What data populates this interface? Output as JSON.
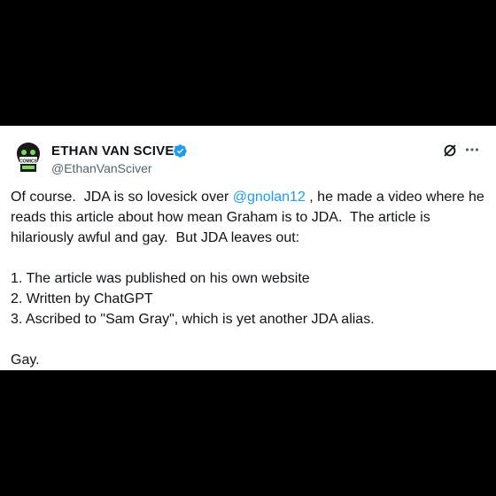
{
  "tweet": {
    "author": {
      "name": "ETHAN VAN SCIVER",
      "handle": "@EthanVanSciver",
      "avatar_text": "COMICS"
    },
    "text": {
      "line1_pre": "Of course.  JDA is so lovesick over ",
      "mention": "@gnolan12",
      "line1_post": " , he made a video where he reads this article about how mean Graham is to JDA.  The article is hilariously awful and gay.  But JDA leaves out:",
      "list": [
        "1. The article was published on his own website",
        "2. Written by ChatGPT",
        "3. Ascribed to \"Sam Gray\", which is yet another JDA alias."
      ],
      "closing": "Gay."
    },
    "icons": {
      "verified": "verified-badge-icon",
      "grok": "grok-icon",
      "more": "more-options-icon"
    },
    "colors": {
      "verified": "#1d9bf0",
      "mention": "#1d9bf0"
    }
  }
}
